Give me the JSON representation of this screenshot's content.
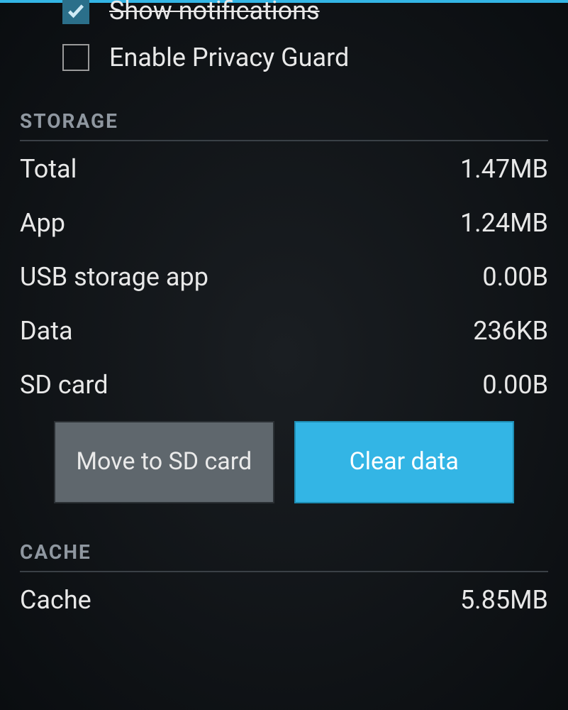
{
  "top": {
    "show_notifications_label": "Show notifications",
    "show_notifications_checked": true,
    "privacy_guard_label": "Enable Privacy Guard",
    "privacy_guard_checked": false
  },
  "sections": {
    "storage_header": "STORAGE",
    "cache_header": "CACHE"
  },
  "storage": {
    "total_label": "Total",
    "total_value": "1.47MB",
    "app_label": "App",
    "app_value": "1.24MB",
    "usb_label": "USB storage app",
    "usb_value": "0.00B",
    "data_label": "Data",
    "data_value": "236KB",
    "sd_label": "SD card",
    "sd_value": "0.00B"
  },
  "buttons": {
    "move_sd": "Move to SD card",
    "clear_data": "Clear data"
  },
  "cache": {
    "cache_label": "Cache",
    "cache_value": "5.85MB"
  }
}
